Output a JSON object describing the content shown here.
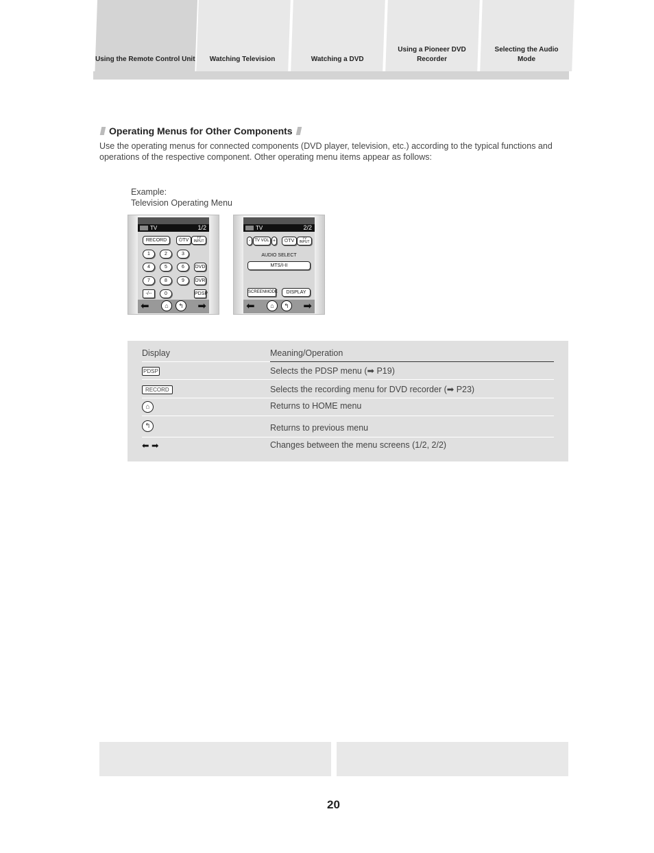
{
  "tabs": [
    {
      "label": "Using the Remote Control Unit",
      "active": true
    },
    {
      "label": "Watching Television"
    },
    {
      "label": "Watching a DVD"
    },
    {
      "label": "Using a Pioneer DVD Recorder"
    },
    {
      "label": "Selecting the Audio Mode"
    }
  ],
  "section": {
    "title": "Operating Menus for Other Components",
    "body": "Use the operating menus for connected components (DVD player, television, etc.) according to the typical functions and operations of the respective component. Other operating menu items appear as follows:",
    "example_label": "Example:",
    "example_caption": "Television Operating Menu"
  },
  "screen1": {
    "title": "TV",
    "page": "1/2",
    "record": "RECORD",
    "power_tv": "⏻TV",
    "tv_input": "TV INPUT",
    "digits": [
      "1",
      "2",
      "3",
      "4",
      "5",
      "6",
      "7",
      "8",
      "9",
      "-/--",
      "0"
    ],
    "dvd": "DVD",
    "dvr": "DVR",
    "pdsp": "PDSP"
  },
  "screen2": {
    "title": "TV",
    "page": "2/2",
    "vol_minus": "-",
    "tv_vol": "TV VOL",
    "vol_plus": "+",
    "power_tv": "⏻TV",
    "tv_input": "TV INPUT",
    "audio_select": "AUDIO SELECT",
    "mts": "MTS/I-II",
    "screen_mode": "SCREENMODE",
    "display": "DISPLAY"
  },
  "table": {
    "headers": [
      "Display",
      "Meaning/Operation"
    ],
    "rows": [
      {
        "display": "PDSP",
        "meaning": "Selects the PDSP menu (➡ P19)"
      },
      {
        "display": "RECORD",
        "meaning": "Selects the recording menu for DVD recorder (➡ P23)"
      },
      {
        "display": "home-icon",
        "meaning": "Returns to HOME menu"
      },
      {
        "display": "return-icon",
        "meaning": "Returns to previous menu"
      },
      {
        "display": "⬅ ➡",
        "meaning": "Changes between the menu screens (1/2, 2/2)"
      }
    ]
  },
  "page_number": "20"
}
